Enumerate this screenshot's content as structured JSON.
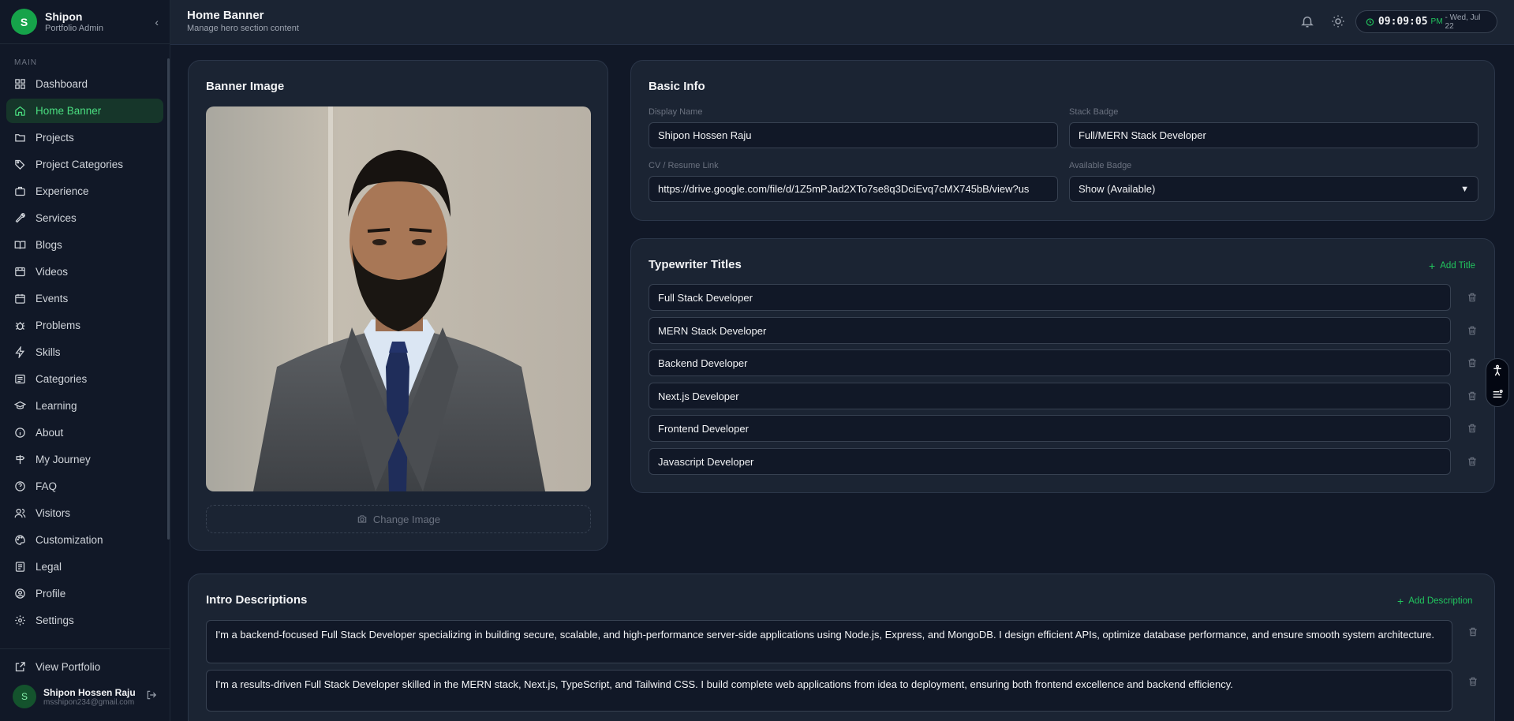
{
  "sidebar": {
    "brand_name": "Shipon",
    "brand_sub": "Portfolio Admin",
    "logo_letter": "S",
    "section": "MAIN",
    "items": [
      {
        "label": "Dashboard",
        "icon": "dashboard-icon"
      },
      {
        "label": "Home Banner",
        "icon": "home-icon",
        "active": true
      },
      {
        "label": "Projects",
        "icon": "folder-icon"
      },
      {
        "label": "Project Categories",
        "icon": "tags-icon"
      },
      {
        "label": "Experience",
        "icon": "briefcase-icon"
      },
      {
        "label": "Services",
        "icon": "wrench-icon"
      },
      {
        "label": "Blogs",
        "icon": "book-icon"
      },
      {
        "label": "Videos",
        "icon": "video-icon"
      },
      {
        "label": "Events",
        "icon": "calendar-icon"
      },
      {
        "label": "Problems",
        "icon": "bug-icon"
      },
      {
        "label": "Skills",
        "icon": "zap-icon"
      },
      {
        "label": "Categories",
        "icon": "list-icon"
      },
      {
        "label": "Learning",
        "icon": "graduation-cap-icon"
      },
      {
        "label": "About",
        "icon": "info-icon"
      },
      {
        "label": "My Journey",
        "icon": "signpost-icon"
      },
      {
        "label": "FAQ",
        "icon": "help-circle-icon"
      },
      {
        "label": "Visitors",
        "icon": "users-icon"
      },
      {
        "label": "Customization",
        "icon": "palette-icon"
      },
      {
        "label": "Legal",
        "icon": "scale-icon"
      },
      {
        "label": "Profile",
        "icon": "user-circle-icon"
      },
      {
        "label": "Settings",
        "icon": "gear-icon"
      }
    ],
    "view_portfolio": "View Portfolio",
    "user": {
      "initial": "S",
      "name": "Shipon Hossen Raju",
      "email": "msshipon234@gmail.com"
    }
  },
  "header": {
    "title": "Home Banner",
    "subtitle": "Manage hero section content",
    "clock_time": "09:09:05",
    "clock_ampm": "PM",
    "clock_date": "- Wed, Jul 22"
  },
  "banner_card": {
    "title": "Banner Image",
    "change_button": "Change Image"
  },
  "basic_info": {
    "title": "Basic Info",
    "display_name_label": "Display Name",
    "display_name": "Shipon Hossen Raju",
    "stack_badge_label": "Stack Badge",
    "stack_badge": "Full/MERN Stack Developer",
    "cv_label": "CV / Resume Link",
    "cv_link": "https://drive.google.com/file/d/1Z5mPJad2XTo7se8q3DciEvq7cMX745bB/view?us",
    "available_label": "Available Badge",
    "available_value": "Show (Available)"
  },
  "typewriter": {
    "title": "Typewriter Titles",
    "add_label": "Add Title",
    "titles": [
      "Full Stack Developer",
      "MERN Stack Developer",
      "Backend Developer",
      "Next.js Developer",
      "Frontend Developer",
      "Javascript Developer"
    ]
  },
  "intro": {
    "title": "Intro Descriptions",
    "add_label": "Add Description",
    "descriptions": [
      "I'm a backend-focused Full Stack Developer specializing in building secure, scalable, and high-performance server-side applications using Node.js, Express, and MongoDB. I design efficient APIs, optimize database performance, and ensure smooth system architecture.",
      "I'm a results-driven Full Stack Developer skilled in the MERN stack, Next.js, TypeScript, and Tailwind CSS. I build complete web applications from idea to deployment, ensuring both frontend excellence and backend efficiency."
    ]
  },
  "colors": {
    "accent": "#22c55e",
    "bg": "#111827",
    "card": "#1b2433"
  }
}
